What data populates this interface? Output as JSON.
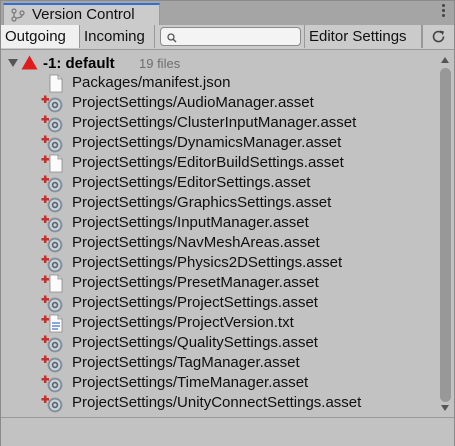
{
  "window": {
    "title": "Version Control"
  },
  "tabs": {
    "outgoing": "Outgoing",
    "incoming": "Incoming",
    "editor_settings": "Editor Settings"
  },
  "search": {
    "placeholder": "",
    "value": ""
  },
  "changelist": {
    "label": "-1: default",
    "count": "19 files",
    "expanded": true
  },
  "files": [
    {
      "path": "Packages/manifest.json",
      "icon": "document-icon",
      "added": false
    },
    {
      "path": "ProjectSettings/AudioManager.asset",
      "icon": "settings-asset-icon",
      "added": true
    },
    {
      "path": "ProjectSettings/ClusterInputManager.asset",
      "icon": "settings-asset-icon",
      "added": true
    },
    {
      "path": "ProjectSettings/DynamicsManager.asset",
      "icon": "settings-asset-icon",
      "added": true
    },
    {
      "path": "ProjectSettings/EditorBuildSettings.asset",
      "icon": "document-icon",
      "added": true
    },
    {
      "path": "ProjectSettings/EditorSettings.asset",
      "icon": "settings-asset-icon",
      "added": true
    },
    {
      "path": "ProjectSettings/GraphicsSettings.asset",
      "icon": "settings-asset-icon",
      "added": true
    },
    {
      "path": "ProjectSettings/InputManager.asset",
      "icon": "settings-asset-icon",
      "added": true
    },
    {
      "path": "ProjectSettings/NavMeshAreas.asset",
      "icon": "settings-asset-icon",
      "added": true
    },
    {
      "path": "ProjectSettings/Physics2DSettings.asset",
      "icon": "settings-asset-icon",
      "added": true
    },
    {
      "path": "ProjectSettings/PresetManager.asset",
      "icon": "document-icon",
      "added": true
    },
    {
      "path": "ProjectSettings/ProjectSettings.asset",
      "icon": "settings-asset-icon",
      "added": true
    },
    {
      "path": "ProjectSettings/ProjectVersion.txt",
      "icon": "text-document-icon",
      "added": true
    },
    {
      "path": "ProjectSettings/QualitySettings.asset",
      "icon": "settings-asset-icon",
      "added": true
    },
    {
      "path": "ProjectSettings/TagManager.asset",
      "icon": "settings-asset-icon",
      "added": true
    },
    {
      "path": "ProjectSettings/TimeManager.asset",
      "icon": "settings-asset-icon",
      "added": true
    },
    {
      "path": "ProjectSettings/UnityConnectSettings.asset",
      "icon": "settings-asset-icon",
      "added": true
    }
  ],
  "colors": {
    "tab_accent": "#2f6fd6",
    "added_badge": "#c4302b",
    "warning": "#e01b1b",
    "text_link_blue": "#3a6fd0"
  }
}
